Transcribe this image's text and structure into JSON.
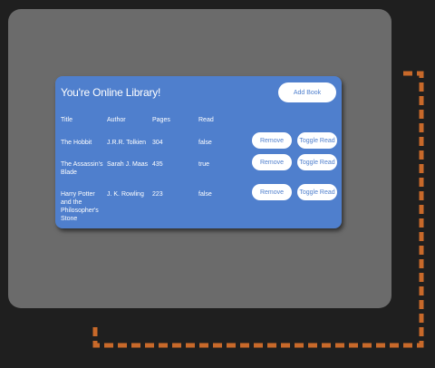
{
  "library": {
    "title": "You're Online Library!",
    "add_button": "Add Book",
    "columns": [
      "Title",
      "Author",
      "Pages",
      "Read"
    ],
    "books": [
      {
        "title": "The Hobbit",
        "author": "J.R.R. Tolkien",
        "pages": "304",
        "read": "false"
      },
      {
        "title": "The Assassin's Blade",
        "author": "Sarah J. Maas",
        "pages": "435",
        "read": "true"
      },
      {
        "title": "Harry Potter and the Philosopher's Stone",
        "author": "J. K. Rowling",
        "pages": "223",
        "read": "false"
      }
    ],
    "remove_label": "Remove",
    "toggle_label": "Toggle Read"
  },
  "colors": {
    "background": "#1f1f1f",
    "panel": "#6b6b6b",
    "card": "#4f7fcd",
    "dashed_frame": "#c8692a"
  }
}
